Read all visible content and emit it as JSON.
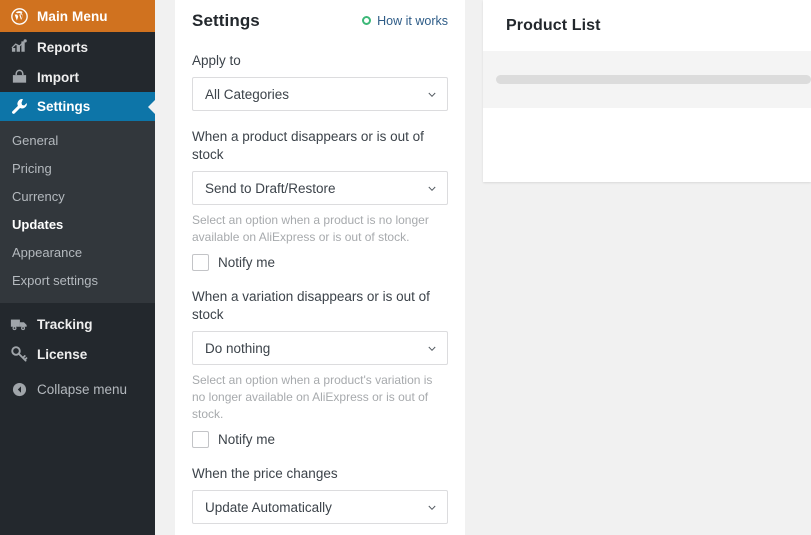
{
  "sidebar": {
    "brand": {
      "label": "Main Menu",
      "icon": "wordpress-icon",
      "color": "#d0721f"
    },
    "items": [
      {
        "label": "Reports",
        "icon": "chart-icon"
      },
      {
        "label": "Import",
        "icon": "bag-icon"
      },
      {
        "label": "Settings",
        "icon": "wrench-icon",
        "current": true
      }
    ],
    "submenu": [
      {
        "label": "General",
        "active": false
      },
      {
        "label": "Pricing",
        "active": false
      },
      {
        "label": "Currency",
        "active": false
      },
      {
        "label": "Updates",
        "active": true
      },
      {
        "label": "Appearance",
        "active": false
      },
      {
        "label": "Export settings",
        "active": false
      }
    ],
    "lower_items": [
      {
        "label": "Tracking",
        "icon": "truck-icon"
      },
      {
        "label": "License",
        "icon": "key-icon"
      }
    ],
    "collapse": {
      "label": "Collapse menu",
      "icon": "collapse-arrow-icon"
    },
    "colors": {
      "background": "#23282d",
      "submenu_background": "#32373c",
      "active": "#0d75a8"
    }
  },
  "settings": {
    "title": "Settings",
    "how_it_works": {
      "label": "How it works",
      "icon": "info-ring-icon",
      "color": "#3cb878"
    },
    "apply_to": {
      "label": "Apply to",
      "value": "All Categories"
    },
    "product_out_of_stock": {
      "label": "When a product disappears or is out of stock",
      "value": "Send to Draft/Restore",
      "hint": "Select an option when a product is no longer available on AliExpress or is out of stock.",
      "notify_label": "Notify me",
      "notify_checked": false
    },
    "variation_out_of_stock": {
      "label": "When a variation disappears or is out of stock",
      "value": "Do nothing",
      "hint": "Select an option when a product's variation is no longer available on AliExpress or is out of stock.",
      "notify_label": "Notify me",
      "notify_checked": false
    },
    "price_changes": {
      "label": "When the price changes",
      "value": "Update Automatically"
    }
  },
  "product_list": {
    "title": "Product List",
    "loading": true
  }
}
